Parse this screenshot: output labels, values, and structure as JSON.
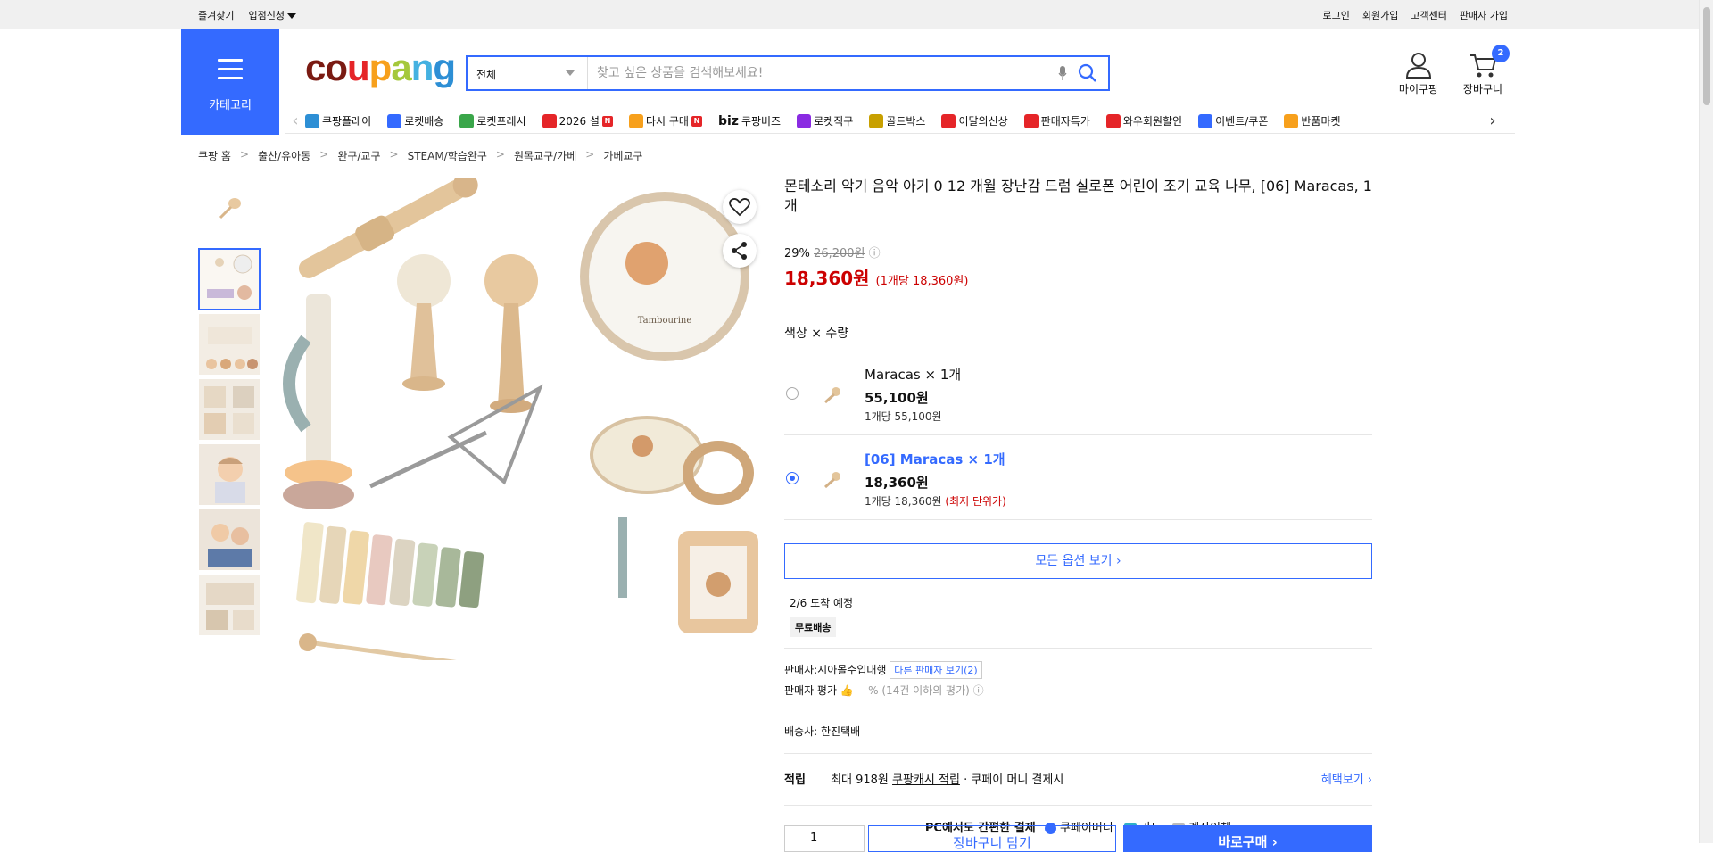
{
  "topbar": {
    "left": [
      "즐겨찾기",
      "입점신청"
    ],
    "right": [
      "로그인",
      "회원가입",
      "고객센터",
      "판매자 가입"
    ]
  },
  "header": {
    "category_label": "카테고리",
    "logo": [
      "c",
      "o",
      "u",
      "p",
      "a",
      "n",
      "g"
    ],
    "search_scope": "전체",
    "search_placeholder": "찾고 싶은 상품을 검색해보세요!",
    "mycoupang": "마이쿠팡",
    "cart_label": "장바구니",
    "cart_count": "2"
  },
  "category_nav": [
    {
      "label": "쿠팡플레이",
      "color": "#2d8fd5"
    },
    {
      "label": "로켓배송",
      "color": "#346aff"
    },
    {
      "label": "로켓프레시",
      "color": "#3aa64a"
    },
    {
      "label": "2026 설",
      "color": "#e52528",
      "badge": "N"
    },
    {
      "label": "다시 구매",
      "color": "#f7a01c",
      "badge": "N"
    },
    {
      "label": "쿠팡비즈",
      "color": "#111111",
      "prefix": "biz"
    },
    {
      "label": "로켓직구",
      "color": "#8a2be2"
    },
    {
      "label": "골드박스",
      "color": "#c8a000"
    },
    {
      "label": "이달의신상",
      "color": "#e52528"
    },
    {
      "label": "판매자특가",
      "color": "#e52528"
    },
    {
      "label": "와우회원할인",
      "color": "#e52528"
    },
    {
      "label": "이벤트/쿠폰",
      "color": "#346aff"
    },
    {
      "label": "반품마켓",
      "color": "#f7a01c"
    }
  ],
  "breadcrumb": [
    "쿠팡 홈",
    "출산/유아동",
    "완구/교구",
    "STEAM/학습완구",
    "원목교구/가베",
    "가베교구"
  ],
  "product": {
    "title": "몬테소리 악기 음악 아기 0 12 개월 장난감 드럼 실로폰 어린이 조기 교육 나무, [06] Maracas, 1개",
    "discount_rate": "29%",
    "original_price": "26,200원",
    "price": "18,360원",
    "unit_price": "(1개당 18,360원)",
    "option_label": "색상 × 수량",
    "options": [
      {
        "name": "Maracas × 1개",
        "price": "55,100원",
        "per": "1개당 55,100원",
        "lowest": "",
        "selected": false
      },
      {
        "name": "[06]  Maracas × 1개",
        "price": "18,360원",
        "per": "1개당 18,360원",
        "lowest": "(최저 단위가)",
        "selected": true
      }
    ],
    "all_options": "모든 옵션 보기",
    "delivery_date": "2/6 도착 예정",
    "free_shipping": "무료배송",
    "seller_label": "판매자:",
    "seller_name": "시아몰수입대행",
    "other_sellers": "다른 판매자 보기(2)",
    "seller_rating_label": "판매자 평가",
    "seller_rating_value": "-- % (14건 이하의 평가)",
    "shipping_company_label": "배송사:",
    "shipping_company": "한진택배",
    "reward_label": "적립",
    "reward_text_a": "최대 918원",
    "reward_link": "쿠팡캐시 적립",
    "reward_text_b": "· 쿠페이 머니 결제시",
    "benefit_link": "혜택보기",
    "pay_title": "PC에서도 간편한 결제",
    "pay_methods": [
      "쿠페이머니",
      "카드",
      "계좌이체"
    ],
    "quantity": "1",
    "add_cart": "장바구니 담기",
    "buy_now": "바로구매"
  },
  "image_text": {
    "tambourine": "Tambourine"
  },
  "colors": {
    "accent": "#346aff",
    "price_red": "#cc0000"
  }
}
